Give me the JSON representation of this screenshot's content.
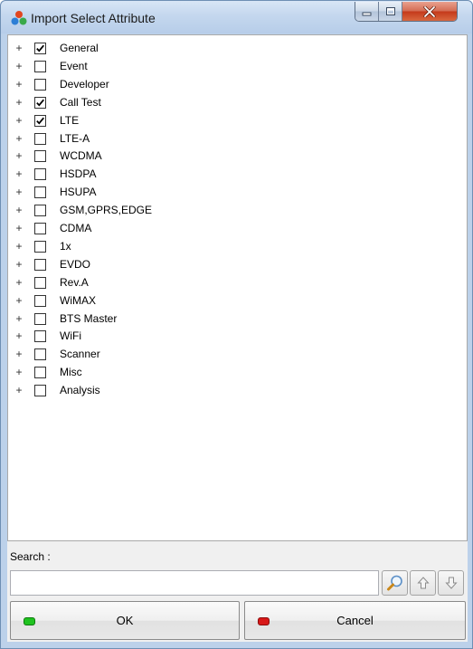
{
  "window": {
    "title": "Import Select Attribute"
  },
  "tree": {
    "items": [
      {
        "label": "General",
        "checked": true
      },
      {
        "label": "Event",
        "checked": false
      },
      {
        "label": "Developer",
        "checked": false
      },
      {
        "label": "Call Test",
        "checked": true
      },
      {
        "label": "LTE",
        "checked": true
      },
      {
        "label": "LTE-A",
        "checked": false
      },
      {
        "label": "WCDMA",
        "checked": false
      },
      {
        "label": "HSDPA",
        "checked": false
      },
      {
        "label": "HSUPA",
        "checked": false
      },
      {
        "label": "GSM,GPRS,EDGE",
        "checked": false
      },
      {
        "label": "CDMA",
        "checked": false
      },
      {
        "label": "1x",
        "checked": false
      },
      {
        "label": "EVDO",
        "checked": false
      },
      {
        "label": "Rev.A",
        "checked": false
      },
      {
        "label": "WiMAX",
        "checked": false
      },
      {
        "label": "BTS Master",
        "checked": false
      },
      {
        "label": "WiFi",
        "checked": false
      },
      {
        "label": "Scanner",
        "checked": false
      },
      {
        "label": "Misc",
        "checked": false
      },
      {
        "label": "Analysis",
        "checked": false
      }
    ],
    "expander_glyph": "+"
  },
  "search": {
    "label": "Search :",
    "value": "",
    "placeholder": ""
  },
  "buttons": {
    "ok": {
      "label": "OK",
      "indicator_color": "#1fc21f"
    },
    "cancel": {
      "label": "Cancel",
      "indicator_color": "#d81818"
    }
  },
  "icons": {
    "app": "app-attribute-icon",
    "search": "magnifier-icon",
    "up": "arrow-up-icon",
    "down": "arrow-down-icon"
  }
}
